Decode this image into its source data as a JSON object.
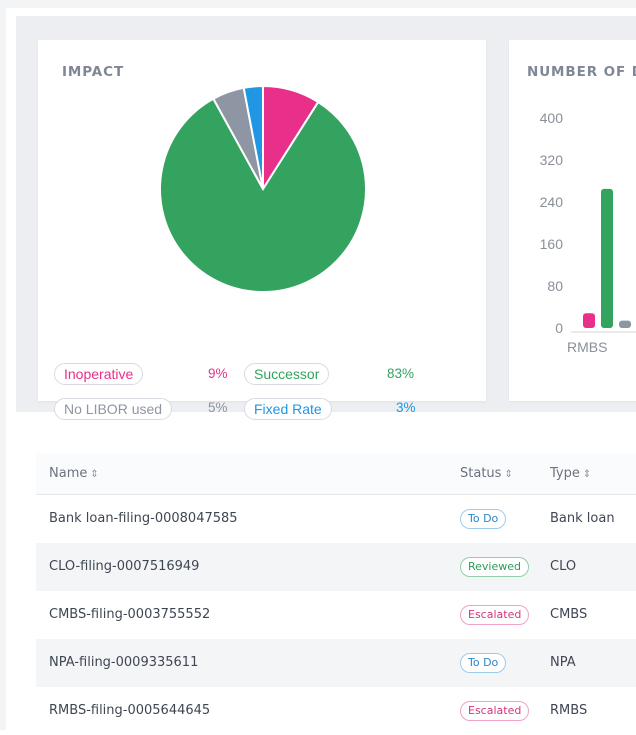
{
  "impact_card": {
    "title": "IMPACT",
    "legend": [
      {
        "label": "Inoperative",
        "pct": "9%",
        "color": "#e8308a"
      },
      {
        "label": "Successor",
        "pct": "83%",
        "color": "#34a35f"
      },
      {
        "label": "No LIBOR used",
        "pct": "5%",
        "color": "#8e95a3"
      },
      {
        "label": "Fixed Rate",
        "pct": "3%",
        "color": "#2196e3"
      }
    ],
    "chart_data": {
      "type": "pie",
      "labels": [
        "Inoperative",
        "Successor",
        "No LIBOR used",
        "Fixed Rate"
      ],
      "values": [
        9,
        83,
        5,
        3
      ],
      "colors": [
        "#e8308a",
        "#34a35f",
        "#8e95a3",
        "#2196e3"
      ]
    }
  },
  "number_card": {
    "title": "NUMBER OF D",
    "chart_data": {
      "type": "bar",
      "categories": [
        "RMBS"
      ],
      "category_labels": [
        "RMBS"
      ],
      "series": [
        {
          "color": "#e8308a",
          "values": [
            28
          ]
        },
        {
          "color": "#34a35f",
          "values": [
            265
          ]
        },
        {
          "color": "#8e95a3",
          "values": [
            14
          ]
        },
        {
          "color": "#2196e3",
          "values": [
            3
          ]
        }
      ],
      "ylim": [
        0,
        400
      ],
      "y_ticks": [
        "400",
        "320",
        "240",
        "160",
        "80",
        "0"
      ]
    }
  },
  "table": {
    "columns": {
      "name": "Name",
      "status": "Status",
      "type": "Type"
    },
    "sort_icon": "⇕",
    "rows": [
      {
        "name": "Bank loan-filing-0008047585",
        "status": "To Do",
        "status_kind": "todo",
        "type": "Bank loan"
      },
      {
        "name": "CLO-filing-0007516949",
        "status": "Reviewed",
        "status_kind": "reviewed",
        "type": "CLO"
      },
      {
        "name": "CMBS-filing-0003755552",
        "status": "Escalated",
        "status_kind": "escalated",
        "type": "CMBS"
      },
      {
        "name": "NPA-filing-0009335611",
        "status": "To Do",
        "status_kind": "todo",
        "type": "NPA"
      },
      {
        "name": "RMBS-filing-0005644645",
        "status": "Escalated",
        "status_kind": "escalated",
        "type": "RMBS"
      }
    ]
  }
}
